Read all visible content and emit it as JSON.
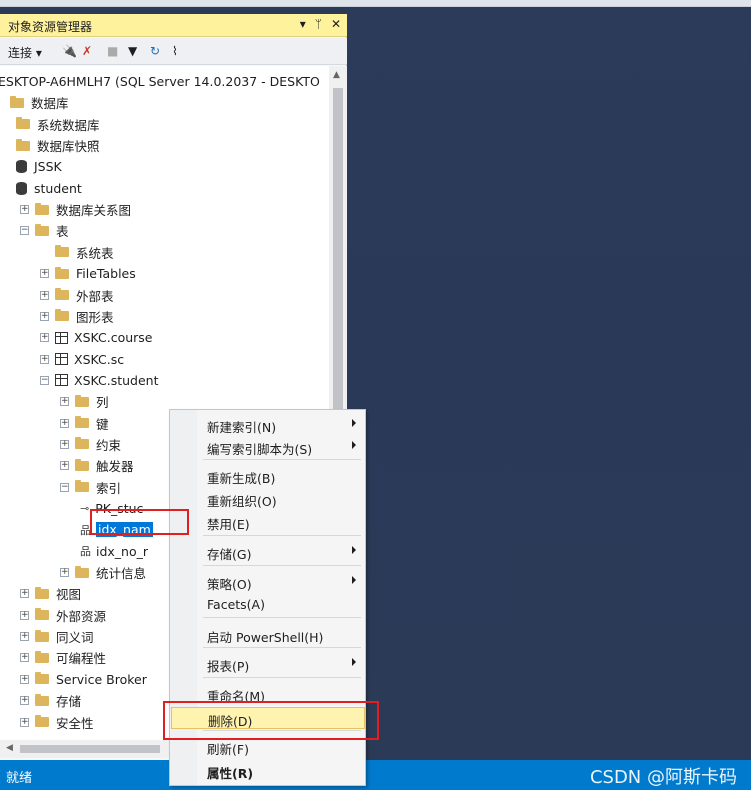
{
  "explorer": {
    "title": "对象资源管理器",
    "title_buttons": [
      "▾",
      "ᛘ",
      "✕"
    ],
    "toolbar": {
      "connect_label": "连接 ▾",
      "icons": [
        "plug-icon",
        "disconnect-icon",
        "stop-icon",
        "filter-icon",
        "refresh-icon",
        "activity-icon"
      ]
    }
  },
  "tree": [
    {
      "label": "ESKTOP-A6HMLH7 (SQL Server 14.0.2037 - DESKTO",
      "icon": "server"
    },
    {
      "label": "数据库",
      "icon": "folder"
    },
    {
      "label": "系统数据库",
      "icon": "folder"
    },
    {
      "label": "数据库快照",
      "icon": "folder"
    },
    {
      "label": "JSSK",
      "icon": "database"
    },
    {
      "label": "student",
      "icon": "database"
    },
    {
      "label": "数据库关系图",
      "icon": "folder",
      "exp": "+"
    },
    {
      "label": "表",
      "icon": "folder",
      "exp": "−"
    },
    {
      "label": "系统表",
      "icon": "folder"
    },
    {
      "label": "FileTables",
      "icon": "folder",
      "exp": "+"
    },
    {
      "label": "外部表",
      "icon": "folder",
      "exp": "+"
    },
    {
      "label": "图形表",
      "icon": "folder",
      "exp": "+"
    },
    {
      "label": "XSKC.course",
      "icon": "table",
      "exp": "+"
    },
    {
      "label": "XSKC.sc",
      "icon": "table",
      "exp": "+"
    },
    {
      "label": "XSKC.student",
      "icon": "table",
      "exp": "−"
    },
    {
      "label": "列",
      "icon": "folder",
      "exp": "+"
    },
    {
      "label": "键",
      "icon": "folder",
      "exp": "+"
    },
    {
      "label": "约束",
      "icon": "folder",
      "exp": "+"
    },
    {
      "label": "触发器",
      "icon": "folder",
      "exp": "+"
    },
    {
      "label": "索引",
      "icon": "folder",
      "exp": "−"
    },
    {
      "label": "PK_stuc",
      "icon": "key"
    },
    {
      "label": "idx_nam",
      "icon": "index",
      "selected": true
    },
    {
      "label": "idx_no_r",
      "icon": "index"
    },
    {
      "label": "统计信息",
      "icon": "folder",
      "exp": "+"
    },
    {
      "label": "视图",
      "icon": "folder",
      "exp": "+"
    },
    {
      "label": "外部资源",
      "icon": "folder",
      "exp": "+"
    },
    {
      "label": "同义词",
      "icon": "folder",
      "exp": "+"
    },
    {
      "label": "可编程性",
      "icon": "folder",
      "exp": "+"
    },
    {
      "label": "Service Broker",
      "icon": "folder",
      "exp": "+"
    },
    {
      "label": "存储",
      "icon": "folder",
      "exp": "+"
    },
    {
      "label": "安全性",
      "icon": "folder",
      "exp": "+"
    }
  ],
  "context_menu": {
    "items": [
      {
        "label": "新建索引(N)",
        "submenu": true
      },
      {
        "label": "编写索引脚本为(S)",
        "submenu": true
      },
      {
        "label": "重新生成(B)"
      },
      {
        "label": "重新组织(O)"
      },
      {
        "label": "禁用(E)"
      },
      {
        "label": "存储(G)",
        "submenu": true
      },
      {
        "label": "策略(O)",
        "submenu": true
      },
      {
        "label": "Facets(A)"
      },
      {
        "label": "启动 PowerShell(H)"
      },
      {
        "label": "报表(P)",
        "submenu": true
      },
      {
        "label": "重命名(M)"
      },
      {
        "label": "删除(D)",
        "highlighted": true
      },
      {
        "label": "刷新(F)"
      },
      {
        "label": "属性(R)",
        "bold": true
      }
    ]
  },
  "status": {
    "text": "就绪"
  },
  "watermark": "CSDN @阿斯卡码",
  "colors": {
    "title_bar": "#fff29d",
    "status_bar": "#007acc",
    "workspace": "#2b3a57",
    "selection": "#0078d7",
    "annotation": "#e02020"
  }
}
